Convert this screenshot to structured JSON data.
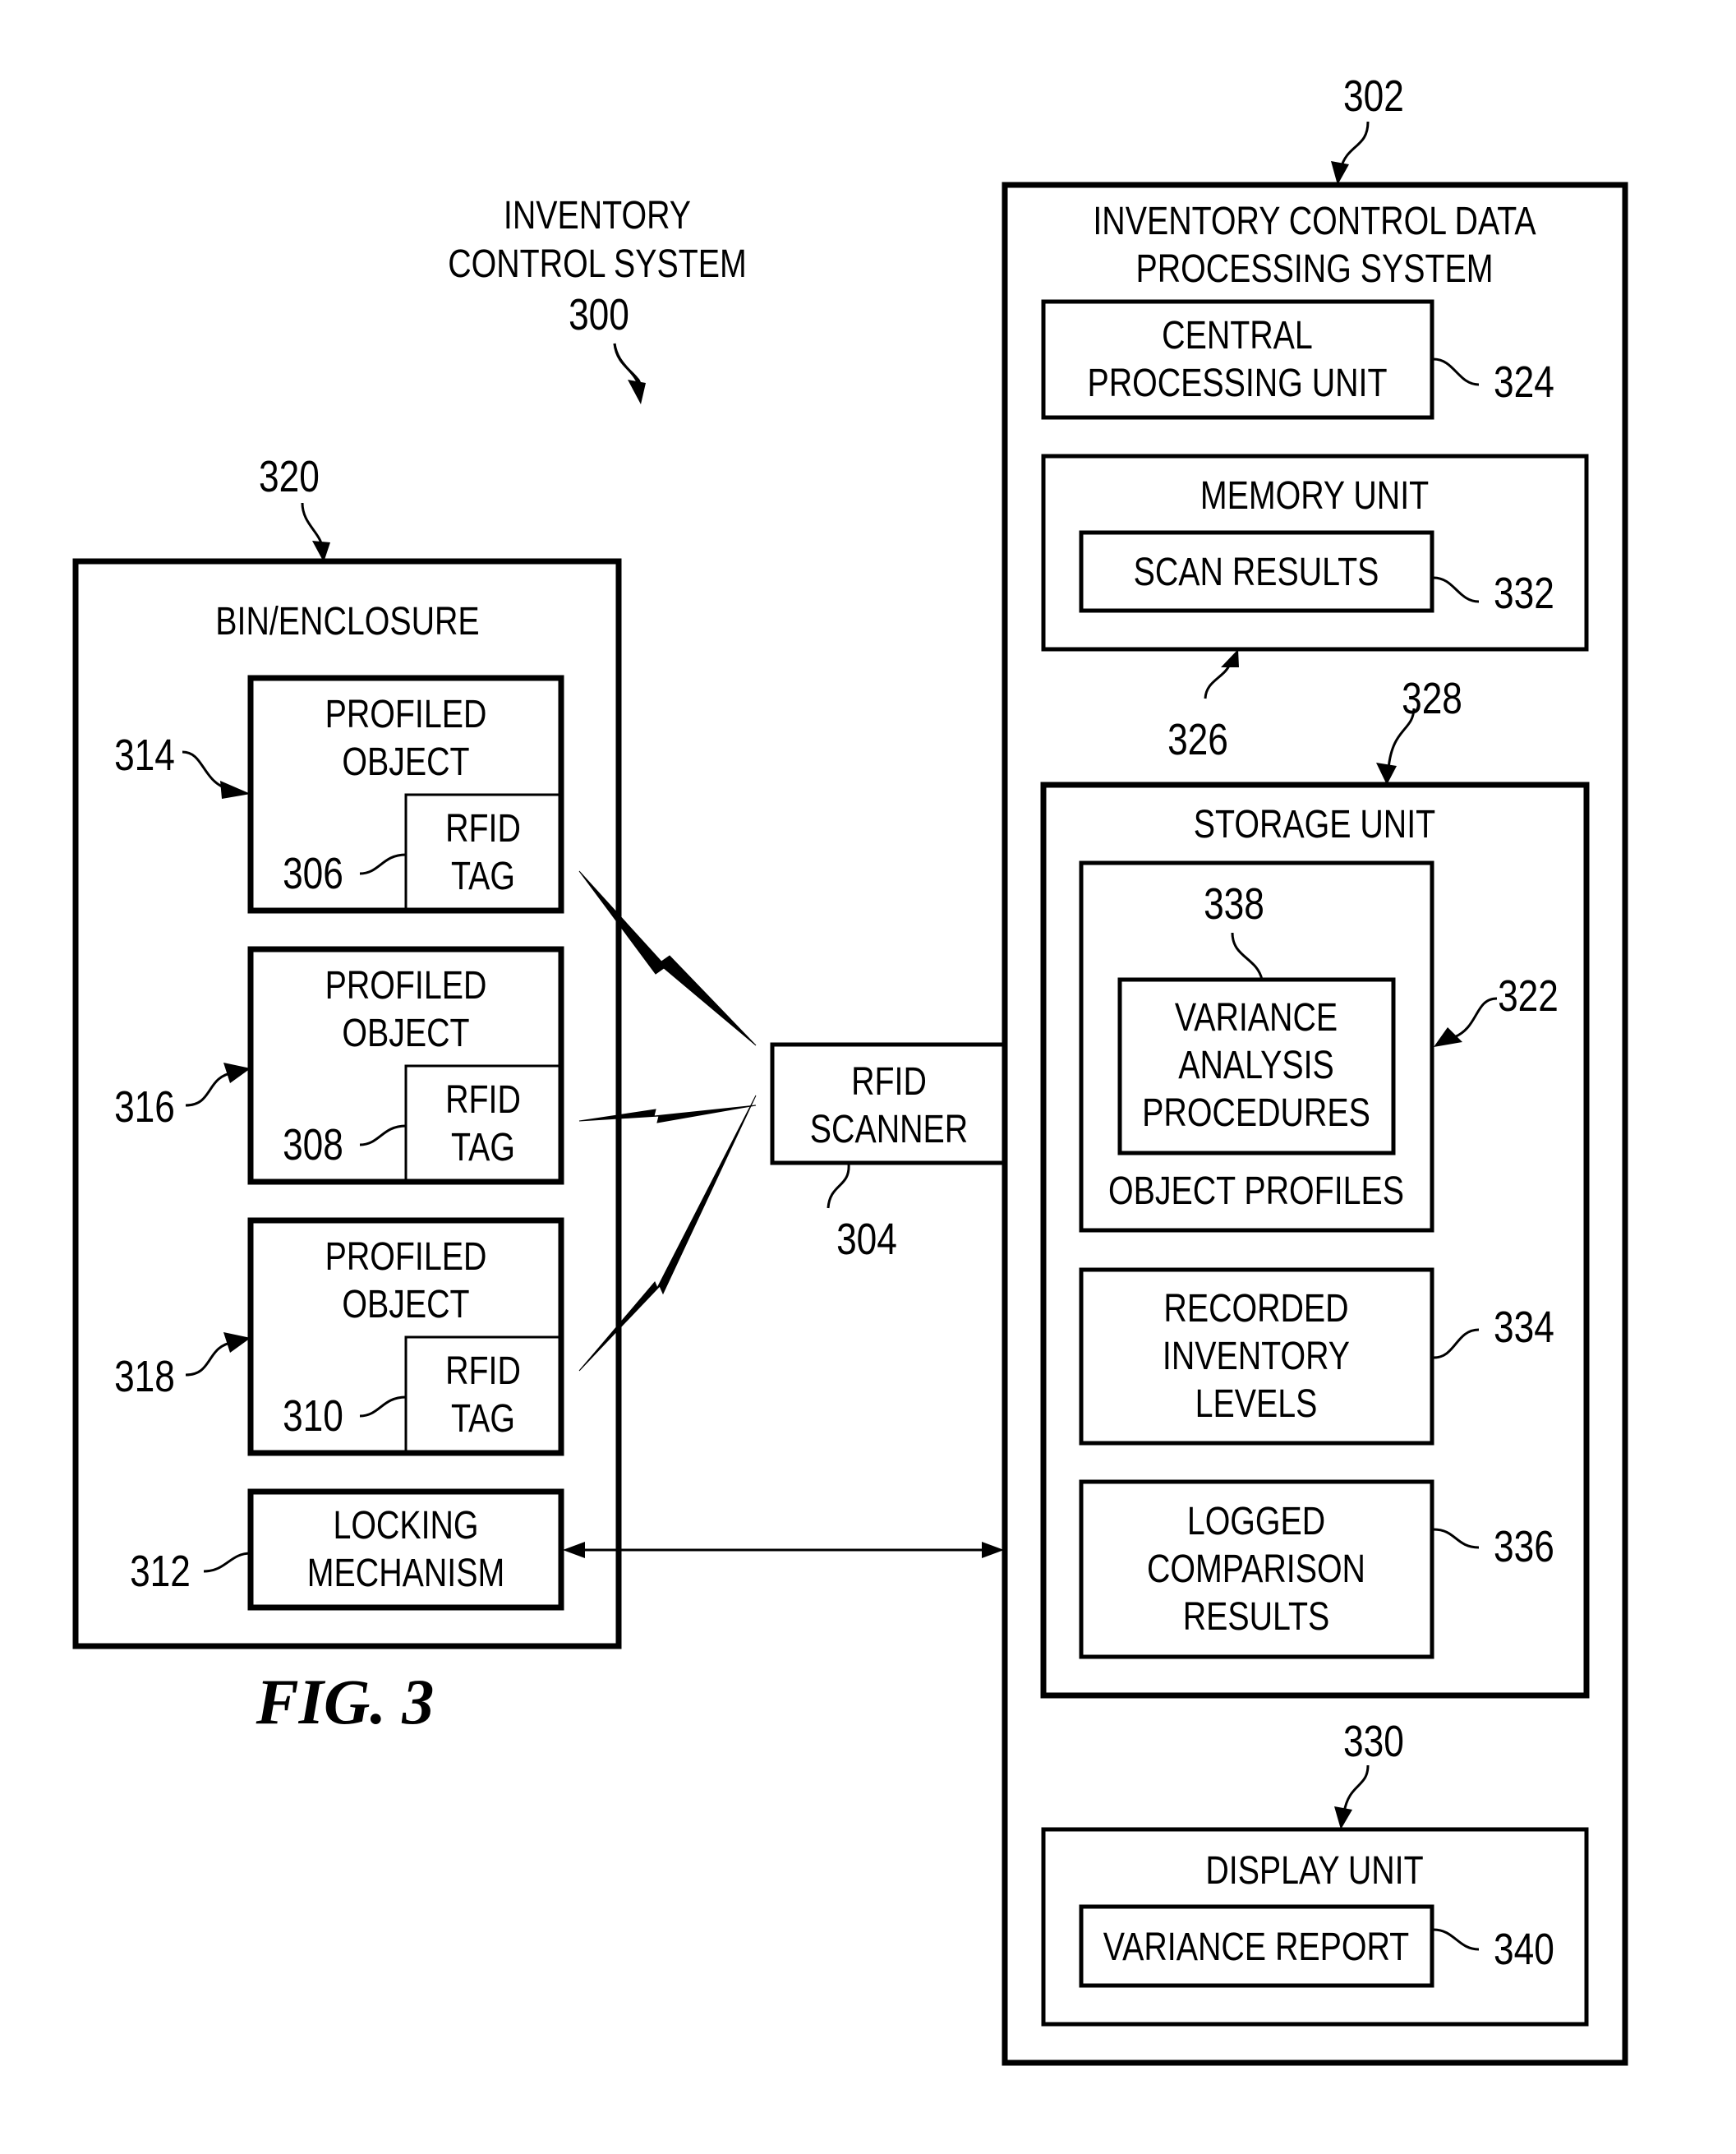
{
  "figure": {
    "caption": "FIG. 3",
    "system": {
      "title_line1": "INVENTORY",
      "title_line2": "CONTROL SYSTEM",
      "ref": "300"
    },
    "bin": {
      "ref": "320",
      "label": "BIN/ENCLOSURE",
      "objects": [
        {
          "ref": "314",
          "label_line1": "PROFILED",
          "label_line2": "OBJECT",
          "tag_ref": "306",
          "tag_line1": "RFID",
          "tag_line2": "TAG"
        },
        {
          "ref": "316",
          "label_line1": "PROFILED",
          "label_line2": "OBJECT",
          "tag_ref": "308",
          "tag_line1": "RFID",
          "tag_line2": "TAG"
        },
        {
          "ref": "318",
          "label_line1": "PROFILED",
          "label_line2": "OBJECT",
          "tag_ref": "310",
          "tag_line1": "RFID",
          "tag_line2": "TAG"
        }
      ],
      "locking": {
        "ref": "312",
        "label_line1": "LOCKING",
        "label_line2": "MECHANISM"
      }
    },
    "scanner": {
      "ref": "304",
      "label_line1": "RFID",
      "label_line2": "SCANNER"
    },
    "data_system": {
      "ref": "302",
      "title_line1": "INVENTORY CONTROL DATA",
      "title_line2": "PROCESSING SYSTEM",
      "cpu": {
        "ref": "324",
        "label_line1": "CENTRAL",
        "label_line2": "PROCESSING UNIT"
      },
      "memory": {
        "label": "MEMORY UNIT",
        "bus_ref": "326",
        "scan_results": {
          "ref": "332",
          "label": "SCAN RESULTS"
        }
      },
      "storage": {
        "ref": "328",
        "label": "STORAGE UNIT",
        "object_profiles": {
          "ref": "322",
          "label": "OBJECT PROFILES",
          "variance_analysis": {
            "ref": "338",
            "label_line1": "VARIANCE",
            "label_line2": "ANALYSIS",
            "label_line3": "PROCEDURES"
          }
        },
        "recorded": {
          "ref": "334",
          "label_line1": "RECORDED",
          "label_line2": "INVENTORY",
          "label_line3": "LEVELS"
        },
        "logged": {
          "ref": "336",
          "label_line1": "LOGGED",
          "label_line2": "COMPARISON",
          "label_line3": "RESULTS"
        }
      },
      "display": {
        "ref": "330",
        "label": "DISPLAY UNIT",
        "report": {
          "ref": "340",
          "label": "VARIANCE REPORT"
        }
      }
    }
  }
}
